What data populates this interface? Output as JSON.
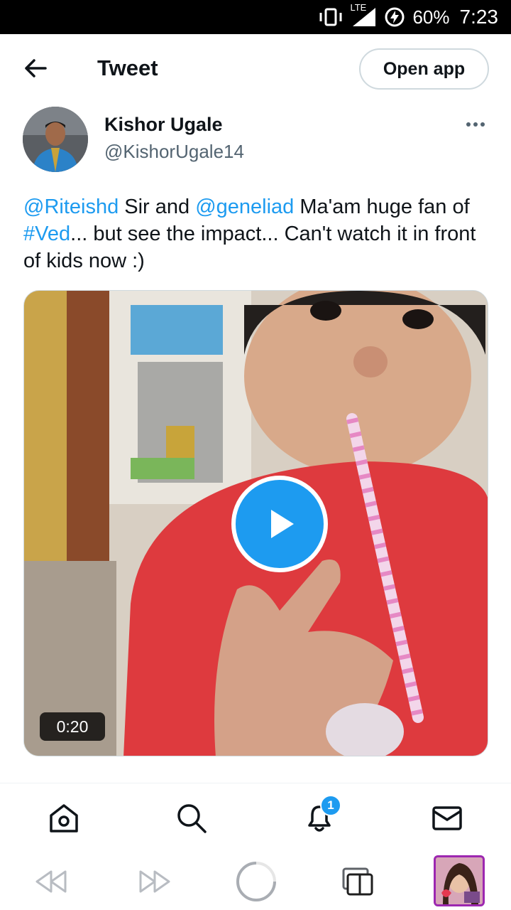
{
  "status_bar": {
    "network": "LTE",
    "battery": "60%",
    "time": "7:23"
  },
  "header": {
    "title": "Tweet",
    "open_app_label": "Open app"
  },
  "tweet": {
    "author_name": "Kishor Ugale",
    "author_handle": "@KishorUgale14",
    "text_parts": [
      {
        "text": "@Riteishd",
        "link": true
      },
      {
        "text": " Sir and ",
        "link": false
      },
      {
        "text": "@geneliad",
        "link": true
      },
      {
        "text": " Ma'am huge fan of ",
        "link": false
      },
      {
        "text": "#Ved",
        "link": true
      },
      {
        "text": "... but see the impact... Can't watch it in front of kids now :)",
        "link": false
      }
    ],
    "video_duration": "0:20"
  },
  "bottom_nav": {
    "items": [
      "home-icon",
      "search-icon",
      "notifications-icon",
      "messages-icon"
    ],
    "notification_count": "1"
  },
  "browser_bar": {
    "items": [
      "back-icon",
      "forward-icon",
      "reload-icon",
      "tabs-icon",
      "profile-thumbnail"
    ]
  },
  "colors": {
    "accent": "#1d9bf0",
    "text": "#0f1419",
    "secondary": "#536471"
  }
}
